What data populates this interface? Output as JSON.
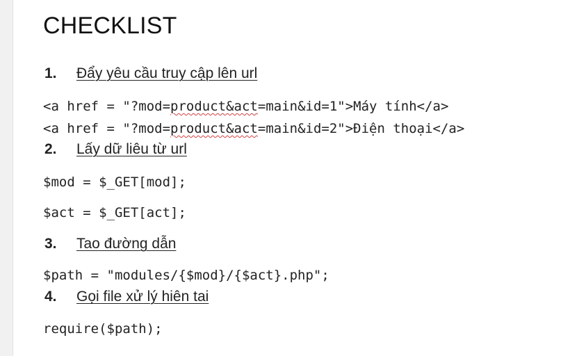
{
  "title": "CHECKLIST",
  "steps": [
    {
      "num": "1.",
      "text": "Đẩy yêu cầu truy cập lên url"
    },
    {
      "num": "2.",
      "text": "Lấy dữ liêu từ url"
    },
    {
      "num": "3.",
      "text": "Tao đường dẫn"
    },
    {
      "num": "4.",
      "text": "Gọi file xử lý hiên tai"
    }
  ],
  "code": {
    "link1_pre": "<a href = \"?mod=",
    "link1_squig": "product&act",
    "link1_post": "=main&id=1\">Máy tính</a>",
    "link2_pre": "<a href = \"?mod=",
    "link2_squig": "product&act",
    "link2_post": "=main&id=2\">Điện thoại</a>",
    "mod_line": "$mod = $_GET[mod];",
    "act_line": "$act = $_GET[act];",
    "path_line": "$path = \"modules/{$mod}/{$act}.php\";",
    "require_line": "require($path);"
  }
}
